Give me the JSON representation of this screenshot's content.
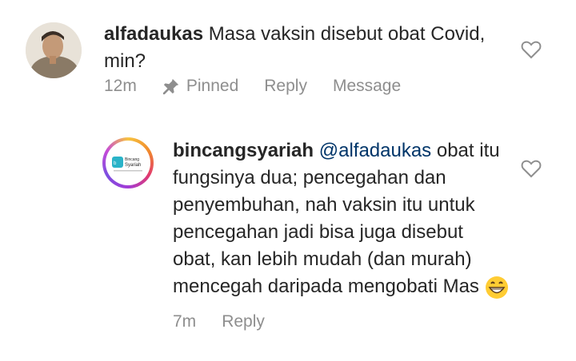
{
  "comments": [
    {
      "username": "alfadaukas",
      "text": "Masa vaksin disebut obat Covid, min?",
      "time": "12m",
      "pinned_label": "Pinned",
      "reply_label": "Reply",
      "message_label": "Message",
      "like_icon": "heart-outline-icon",
      "avatar_icon": "profile-photo"
    },
    {
      "username": "bincangsyariah",
      "mention": "@alfadaukas",
      "text": "obat itu fungsinya dua; pencegahan dan penyembuhan, nah vaksin itu untuk pencegahan jadi bisa juga disebut obat, kan lebih mudah (dan murah) mencegah daripada mengobati Mas",
      "emoji": "grinning-face-emoji",
      "time": "7m",
      "reply_label": "Reply",
      "like_icon": "heart-outline-icon",
      "avatar_logo_text": "Bincang Syariah",
      "avatar_logo_brand": "bincang"
    }
  ],
  "colors": {
    "text": "#262626",
    "meta": "#8e8e8e",
    "mention": "#003569",
    "background": "#ffffff"
  }
}
